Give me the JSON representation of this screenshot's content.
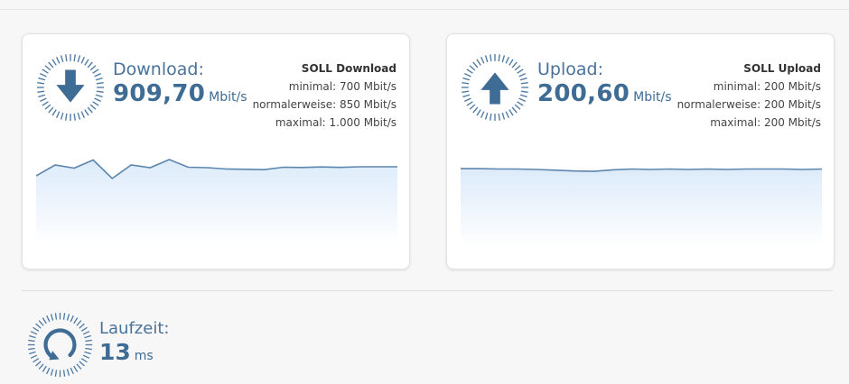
{
  "colors": {
    "accent": "#3e6c95",
    "line": "#5c86ad",
    "fill_top": "#dcebfa",
    "gauge_ticks": "#4f7aa3"
  },
  "download": {
    "label": "Download:",
    "value": "909,70",
    "unit": "Mbit/s",
    "icon": "arrow-down-icon",
    "soll_title": "SOLL Download",
    "soll_min": "minimal: 700 Mbit/s",
    "soll_normal": "normalerweise: 850 Mbit/s",
    "soll_max": "maximal: 1.000 Mbit/s"
  },
  "upload": {
    "label": "Upload:",
    "value": "200,60",
    "unit": "Mbit/s",
    "icon": "arrow-up-icon",
    "soll_title": "SOLL Upload",
    "soll_min": "minimal: 200 Mbit/s",
    "soll_normal": "normalerweise: 200 Mbit/s",
    "soll_max": "maximal: 200 Mbit/s"
  },
  "latency": {
    "label": "Laufzeit:",
    "value": "13",
    "unit": "ms",
    "icon": "refresh-icon"
  },
  "chart_data": [
    {
      "type": "area",
      "series": [
        {
          "values": [
            780,
            900,
            865,
            955,
            750,
            900,
            870,
            960,
            875,
            870,
            855,
            852,
            848,
            875,
            872,
            878,
            873,
            880,
            880,
            880
          ]
        }
      ],
      "ylim": [
        0,
        1100
      ]
    },
    {
      "type": "area",
      "series": [
        {
          "values": [
            203,
            203,
            202,
            202,
            201,
            199,
            197,
            196,
            200,
            202,
            201,
            202,
            201,
            202,
            201,
            202,
            202,
            202,
            201,
            202
          ]
        }
      ],
      "ylim": [
        0,
        260
      ]
    }
  ]
}
